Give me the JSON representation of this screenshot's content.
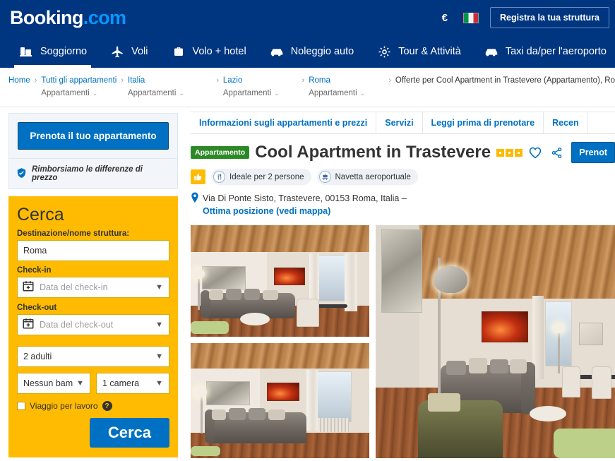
{
  "header": {
    "logo_main": "Booking",
    "logo_suffix": ".com",
    "currency_symbol": "€",
    "currency_name": "euro-currency",
    "flag_name": "italy-flag",
    "register_label": "Registra la tua struttura",
    "nav": [
      {
        "label": "Soggiorno",
        "icon": "bed-icon",
        "active": true
      },
      {
        "label": "Voli",
        "icon": "airplane-icon",
        "active": false
      },
      {
        "label": "Volo + hotel",
        "icon": "suitcase-icon",
        "active": false
      },
      {
        "label": "Noleggio auto",
        "icon": "car-icon",
        "active": false
      },
      {
        "label": "Tour & Attività",
        "icon": "gear-icon",
        "active": false
      },
      {
        "label": "Taxi da/per l'aeroporto",
        "icon": "taxi-icon",
        "active": false
      }
    ]
  },
  "breadcrumb": {
    "home": "Home",
    "items": [
      {
        "link": "Tutti gli appartamenti",
        "sub": "Appartamenti"
      },
      {
        "link": "Italia",
        "sub": "Appartamenti"
      },
      {
        "link": "Lazio",
        "sub": "Appartamenti"
      },
      {
        "link": "Roma",
        "sub": "Appartamenti"
      }
    ],
    "current": "Offerte per Cool Apartment in Trastevere (Appartamento), Ro",
    "separator": "›",
    "caret": "⌄"
  },
  "sidebar": {
    "book_button": "Prenota il tuo appartamento",
    "refund_text": "Rimborsiamo le differenze di prezzo",
    "search": {
      "title": "Cerca",
      "destination_label": "Destinazione/nome struttura:",
      "destination_value": "Roma",
      "checkin_label": "Check-in",
      "checkin_placeholder": "Data del check-in",
      "checkout_label": "Check-out",
      "checkout_placeholder": "Data del check-out",
      "adults_value": "2 adulti",
      "children_value": "Nessun bam",
      "rooms_value": "1 camera",
      "business_label": "Viaggio per lavoro",
      "help_symbol": "?",
      "search_button": "Cerca"
    }
  },
  "main": {
    "tabs": [
      {
        "label": "Informazioni sugli appartamenti e prezzi"
      },
      {
        "label": "Servizi"
      },
      {
        "label": "Leggi prima di prenotare"
      },
      {
        "label": "Recen"
      }
    ],
    "property": {
      "type_badge": "Appartamento",
      "name": "Cool Apartment in Trastevere",
      "stars": 3,
      "book_button": "Prenot",
      "wishlist_icon": "heart-icon",
      "share_icon": "share-icon",
      "refund_text": "",
      "facilities": [
        {
          "label": "Ideale per 2 persone",
          "icon": "cutlery-icon"
        },
        {
          "label": "Navetta aeroportuale",
          "icon": "shuttle-icon"
        }
      ],
      "thumbs_icon": "thumbs-up-icon",
      "address": "Via Di Ponte Sisto, Trastevere, 00153 Roma, Italia –",
      "location_link": "Ottima posizione (vedi mappa)",
      "pin_icon": "map-pin-icon"
    },
    "gallery": {
      "photos": [
        {
          "name": "apartment-photo-living-room-1"
        },
        {
          "name": "apartment-photo-living-room-2"
        },
        {
          "name": "apartment-photo-living-room-main"
        }
      ]
    }
  },
  "colors": {
    "brand_blue": "#003580",
    "accent_blue": "#0071c2",
    "search_yellow": "#febb02",
    "badge_green": "#2c8a26",
    "star_orange": "#feba02"
  }
}
